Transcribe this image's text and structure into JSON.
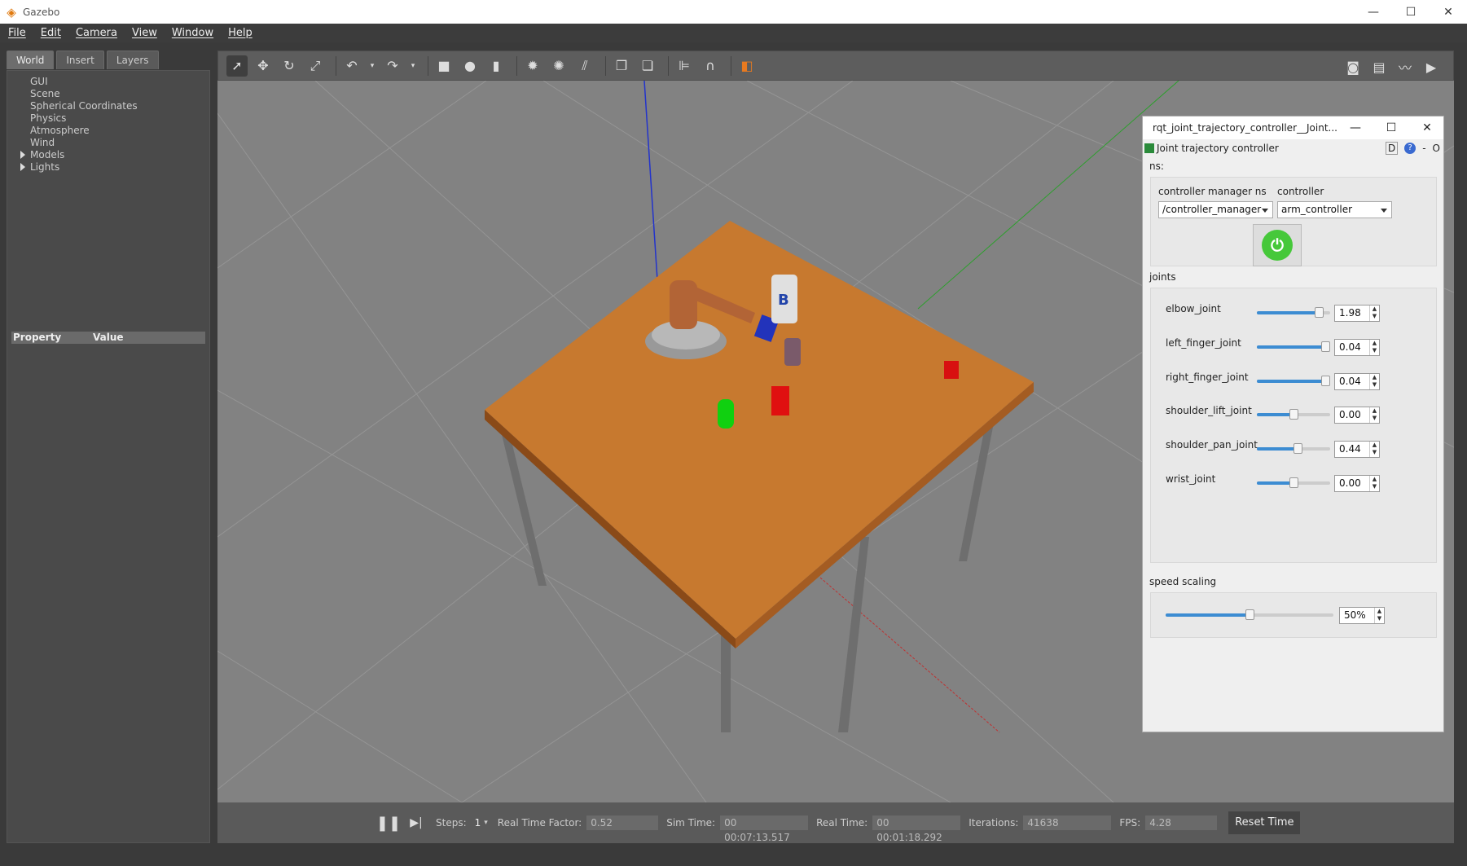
{
  "window": {
    "title": "Gazebo",
    "controls": [
      "—",
      "☐",
      "✕"
    ]
  },
  "menu": [
    "File",
    "Edit",
    "Camera",
    "View",
    "Window",
    "Help"
  ],
  "left_panel": {
    "tabs": [
      "World",
      "Insert",
      "Layers"
    ],
    "active_tab": "World",
    "tree": [
      {
        "label": "GUI",
        "expandable": false
      },
      {
        "label": "Scene",
        "expandable": false
      },
      {
        "label": "Spherical Coordinates",
        "expandable": false
      },
      {
        "label": "Physics",
        "expandable": false
      },
      {
        "label": "Atmosphere",
        "expandable": false
      },
      {
        "label": "Wind",
        "expandable": false
      },
      {
        "label": "Models",
        "expandable": true
      },
      {
        "label": "Lights",
        "expandable": true
      }
    ],
    "property_header": {
      "property": "Property",
      "value": "Value"
    }
  },
  "toolbar": {
    "icons": [
      "select-icon",
      "translate-icon",
      "rotate-icon",
      "scale-icon",
      "undo-icon",
      "undo-dropdown-icon",
      "redo-icon",
      "redo-dropdown-icon",
      "box-icon",
      "sphere-icon",
      "cylinder-icon",
      "point-light-icon",
      "spot-light-icon",
      "directional-light-icon",
      "copy-icon",
      "paste-icon",
      "align-icon",
      "snap-icon",
      "view-angle-icon"
    ],
    "right_icons": [
      "screenshot-icon",
      "log-icon",
      "plot-icon",
      "video-icon"
    ]
  },
  "bottom": {
    "steps_label": "Steps:",
    "steps_value": "1",
    "rtf_label": "Real Time Factor:",
    "rtf_value": "0.52",
    "sim_label": "Sim Time:",
    "sim_value": "00 00:07:13.517",
    "real_label": "Real Time:",
    "real_value": "00 00:01:18.292",
    "iter_label": "Iterations:",
    "iter_value": "41638",
    "fps_label": "FPS:",
    "fps_value": "4.28",
    "reset_label": "Reset Time"
  },
  "rqt": {
    "title": "rqt_joint_trajectory_controller__Joint...",
    "controls": [
      "—",
      "☐",
      "✕"
    ],
    "plugin_title": "Joint trajectory controller",
    "plugin_right": [
      "D",
      "?",
      "-",
      "O"
    ],
    "ns_label": "ns:",
    "cm_label": "controller manager ns",
    "ctrl_label": "controller",
    "cm_value": "/controller_manager",
    "ctrl_value": "arm_controller",
    "joints_label": "joints",
    "joints": [
      {
        "name": "elbow_joint",
        "value": "1.98",
        "frac": 0.9
      },
      {
        "name": "left_finger_joint",
        "value": "0.04",
        "frac": 1.0
      },
      {
        "name": "right_finger_joint",
        "value": "0.04",
        "frac": 1.0
      },
      {
        "name": "shoulder_lift_joint",
        "value": "0.00",
        "frac": 0.5
      },
      {
        "name": "shoulder_pan_joint",
        "value": "0.44",
        "frac": 0.57
      },
      {
        "name": "wrist_joint",
        "value": "0.00",
        "frac": 0.5
      }
    ],
    "speed_label": "speed scaling",
    "speed_value": "50%",
    "speed_frac": 0.5
  },
  "colors": {
    "accent": "#3c8cd2",
    "power": "#46c83a"
  }
}
